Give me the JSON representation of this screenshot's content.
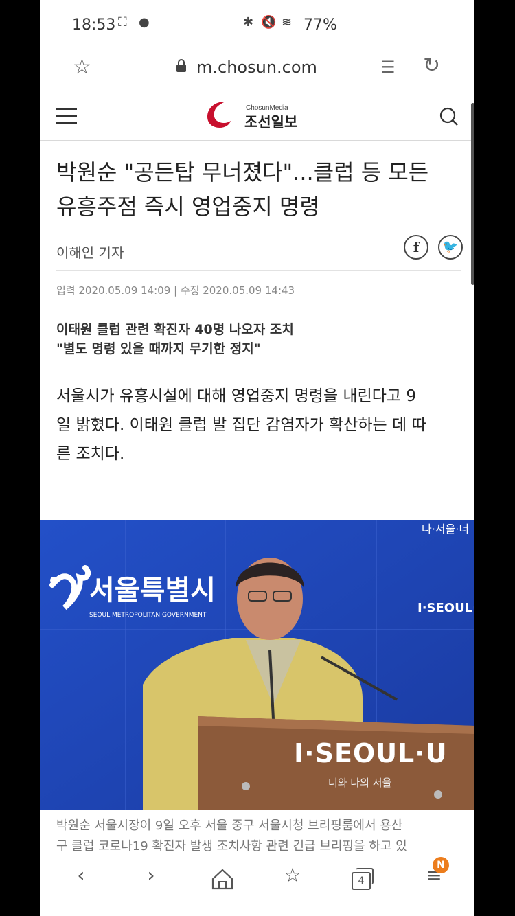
{
  "status_bar": {
    "time": "18:53",
    "battery": "77%"
  },
  "browser": {
    "url": "m.chosun.com"
  },
  "site": {
    "brand_small": "ChosunMedia",
    "brand_name": "조선일보"
  },
  "article": {
    "headline_line1": "박원순 \"공든탑 무너졌다\"...클럽 등 모든",
    "headline_line2": "유흥주점 즉시 영업중지 명령",
    "author": "이해인 기자",
    "dates": "입력 2020.05.09 14:09 | 수정 2020.05.09 14:43",
    "subhead_line1": "이태원 클럽 관련 확진자 40명 나오자 조치",
    "subhead_line2": "\"별도 명령 있을 때까지 무기한 정지\"",
    "body_line1": "서울시가 유흥시설에 대해 영업중지 명령을 내린다고 9",
    "body_line2": "일 밝혔다. 이태원 클럽 발 집단 감염자가 확산하는 데 따",
    "body_line3": "른 조치다.",
    "photo": {
      "wall_text": "서울특별시",
      "wall_subtext": "SEOUL METROPOLITAN GOVERNMENT",
      "slogan": "I·SEOUL·U",
      "slogan_sub": "너와 나의 서울",
      "small_slogan": "나·서울·너"
    },
    "caption_line1": "박원순 서울시장이 9일 오후 서울 중구 서울시청 브리핑룸에서 용산",
    "caption_line2": "구 클럽 코로나19 확진자 발생 조치사항 관련 긴급 브리핑을 하고 있"
  },
  "bottom_nav": {
    "tab_count": "4",
    "badge": "N"
  },
  "colors": {
    "brand_red": "#c8102e",
    "photo_blue": "#1f46b8",
    "badge_orange": "#ec7d1d"
  }
}
